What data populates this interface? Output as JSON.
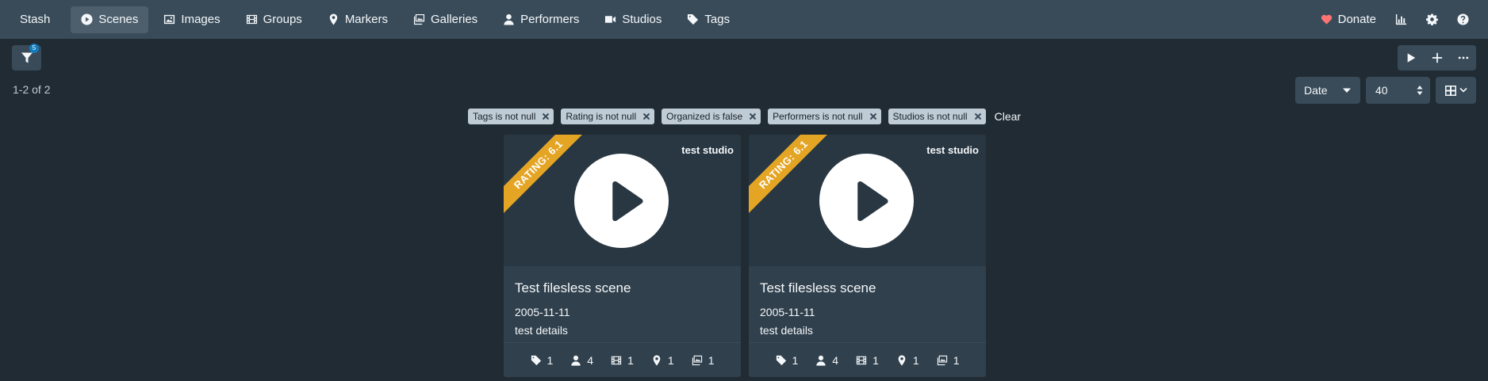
{
  "navbar": {
    "brand": "Stash",
    "items": [
      {
        "label": "Scenes",
        "icon": "play-circle-icon",
        "active": true
      },
      {
        "label": "Images",
        "icon": "image-icon"
      },
      {
        "label": "Groups",
        "icon": "film-icon"
      },
      {
        "label": "Markers",
        "icon": "map-marker-icon"
      },
      {
        "label": "Galleries",
        "icon": "images-icon"
      },
      {
        "label": "Performers",
        "icon": "user-icon"
      },
      {
        "label": "Studios",
        "icon": "video-icon"
      },
      {
        "label": "Tags",
        "icon": "tag-icon"
      }
    ],
    "donate_label": "Donate",
    "accent_heart": "#ff7373"
  },
  "toolbar": {
    "filter_badge": "5",
    "count_text": "1-2 of 2",
    "sort_by": "Date",
    "per_page": "40",
    "criteria": [
      "Tags is not null",
      "Rating is not null",
      "Organized is false",
      "Performers is not null",
      "Studios is not null"
    ],
    "clear_label": "Clear"
  },
  "scenes": [
    {
      "title": "Test filesless scene",
      "date": "2005-11-11",
      "details": "test details",
      "studio": "test studio",
      "rating": "RATING: 6.1",
      "counts": {
        "tags": "1",
        "performers": "4",
        "groups": "1",
        "markers": "1",
        "galleries": "1"
      }
    },
    {
      "title": "Test filesless scene",
      "date": "2005-11-11",
      "details": "test details",
      "studio": "test studio",
      "rating": "RATING: 6.1",
      "counts": {
        "tags": "1",
        "performers": "4",
        "groups": "1",
        "markers": "1",
        "galleries": "1"
      }
    }
  ],
  "colors": {
    "background": "#202b33",
    "navbar": "#394b59",
    "card": "#30404d",
    "rating_ribbon": "#e5a524",
    "criterion_tag": "#bfccd6"
  }
}
